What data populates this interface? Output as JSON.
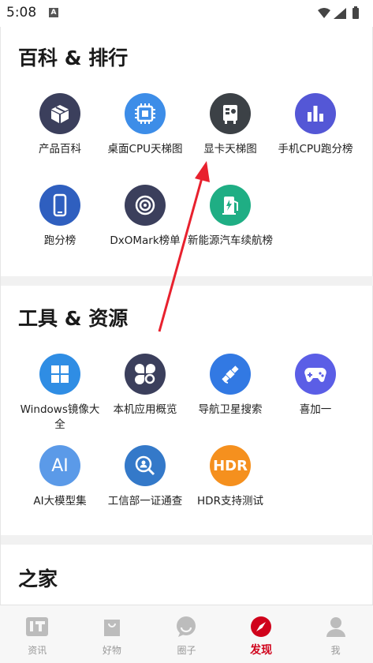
{
  "status_bar": {
    "time": "5:08",
    "notification_icon": "A"
  },
  "sections": [
    {
      "title": "百科 & 排行"
    },
    {
      "title": "工具 & 资源"
    },
    {
      "title": "之家"
    }
  ],
  "rankings": [
    {
      "label": "产品百科",
      "icon": "box-icon",
      "color": "#3b3f5c"
    },
    {
      "label": "桌面CPU天梯图",
      "icon": "cpu-chip-icon",
      "color": "#3d8de8"
    },
    {
      "label": "显卡天梯图",
      "icon": "graphics-card-icon",
      "color": "#3c4146"
    },
    {
      "label": "手机CPU跑分榜",
      "icon": "bar-chart-icon",
      "color": "#5457d6"
    },
    {
      "label": "跑分榜",
      "icon": "phone-icon",
      "color": "#2f5fbf"
    },
    {
      "label": "DxOMark榜单",
      "icon": "camera-lens-icon",
      "color": "#3b3f5c"
    },
    {
      "label": "新能源汽车续航榜",
      "icon": "charging-station-icon",
      "color": "#1fae84"
    }
  ],
  "tools": [
    {
      "label": "Windows镜像大全",
      "icon": "windows-logo-icon",
      "color": "#2f8de4"
    },
    {
      "label": "本机应用概览",
      "icon": "apps-clover-icon",
      "color": "#3b3f5c"
    },
    {
      "label": "导航卫星搜索",
      "icon": "satellite-icon",
      "color": "#3279e3"
    },
    {
      "label": "喜加一",
      "icon": "gamepad-icon",
      "color": "#5b5ee6"
    },
    {
      "label": "AI大模型集",
      "icon_text": "AI",
      "icon": "ai-text-icon",
      "color": "#5b9ae8"
    },
    {
      "label": "工信部一证通查",
      "icon": "id-search-icon",
      "color": "#3479c9"
    },
    {
      "label": "HDR支持测试",
      "icon_text": "HDR",
      "icon": "hdr-text-icon",
      "color": "#f5901e"
    }
  ],
  "tabbar": [
    {
      "label": "资讯",
      "icon": "it-logo-icon",
      "active": false
    },
    {
      "label": "好物",
      "icon": "shopping-bag-icon",
      "active": false
    },
    {
      "label": "圈子",
      "icon": "chat-bubble-icon",
      "active": false
    },
    {
      "label": "发现",
      "icon": "compass-icon",
      "active": true
    },
    {
      "label": "我",
      "icon": "person-icon",
      "active": false
    }
  ],
  "colors": {
    "accent": "#d0021b",
    "annotation_arrow": "#e8212e"
  }
}
